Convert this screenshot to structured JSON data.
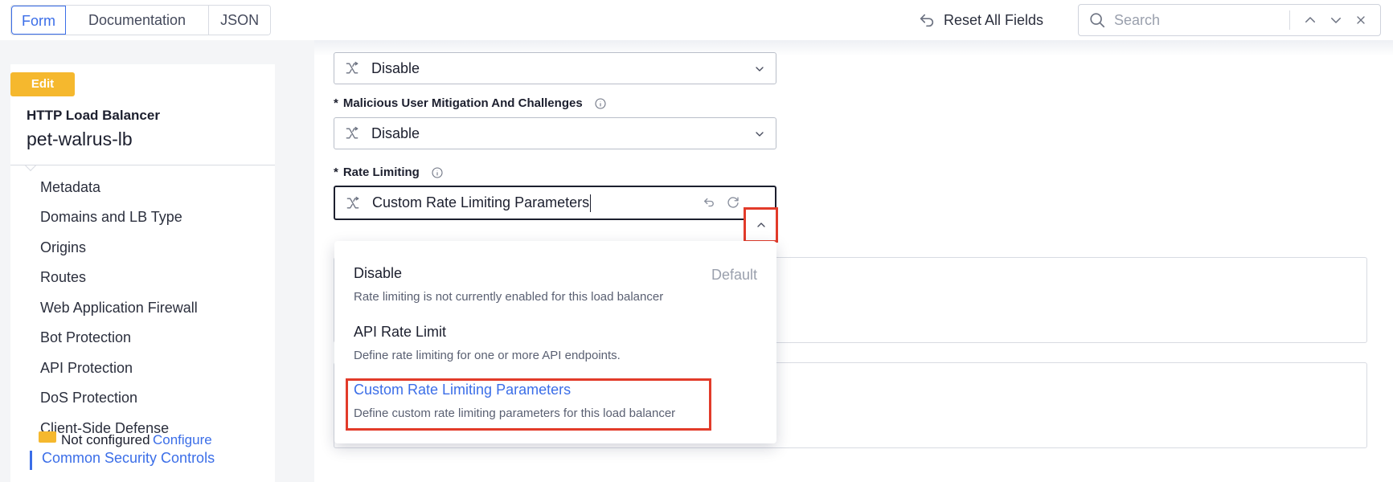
{
  "top_tabs": [
    {
      "label": "Form",
      "active": true
    },
    {
      "label": "Documentation",
      "active": false
    },
    {
      "label": "JSON",
      "active": false
    }
  ],
  "reset_label": "Reset All Fields",
  "search": {
    "placeholder": "Search",
    "value": ""
  },
  "sidebar": {
    "edit_label": "Edit",
    "object_type": "HTTP Load Balancer",
    "object_name": "pet-walrus-lb",
    "items": [
      {
        "label": "Metadata"
      },
      {
        "label": "Domains and LB Type"
      },
      {
        "label": "Origins"
      },
      {
        "label": "Routes"
      },
      {
        "label": "Web Application Firewall"
      },
      {
        "label": "Bot Protection"
      },
      {
        "label": "API Protection"
      },
      {
        "label": "DoS Protection"
      },
      {
        "label": "Client-Side Defense"
      },
      {
        "label": "Common Security Controls",
        "active": true
      }
    ]
  },
  "form": {
    "top_select_value": "Disable",
    "malicious_label": "Malicious User Mitigation And Challenges",
    "malicious_value": "Disable",
    "rate_label": "Rate Limiting",
    "rate_value": "Custom Rate Limiting Parameters",
    "required_mark": "*",
    "not_configured_text": "Not configured",
    "configure_link": "Configure"
  },
  "dropdown": {
    "options": [
      {
        "title": "Disable",
        "desc": "Rate limiting is not currently enabled for this load balancer",
        "tag": "Default"
      },
      {
        "title": "API Rate Limit",
        "desc": "Define rate limiting for one or more API endpoints."
      },
      {
        "title": "Custom Rate Limiting Parameters",
        "desc": "Define custom rate limiting parameters for this load balancer",
        "selected": true
      }
    ]
  },
  "colors": {
    "accent": "#3b6ee8",
    "edit_badge": "#f5b82e",
    "highlight": "#e23b2a"
  },
  "icons": [
    "undo-icon",
    "search-icon",
    "chevron-up-icon",
    "chevron-down-icon",
    "close-icon",
    "merge-icon",
    "info-icon",
    "reset-icon",
    "refresh-icon"
  ]
}
